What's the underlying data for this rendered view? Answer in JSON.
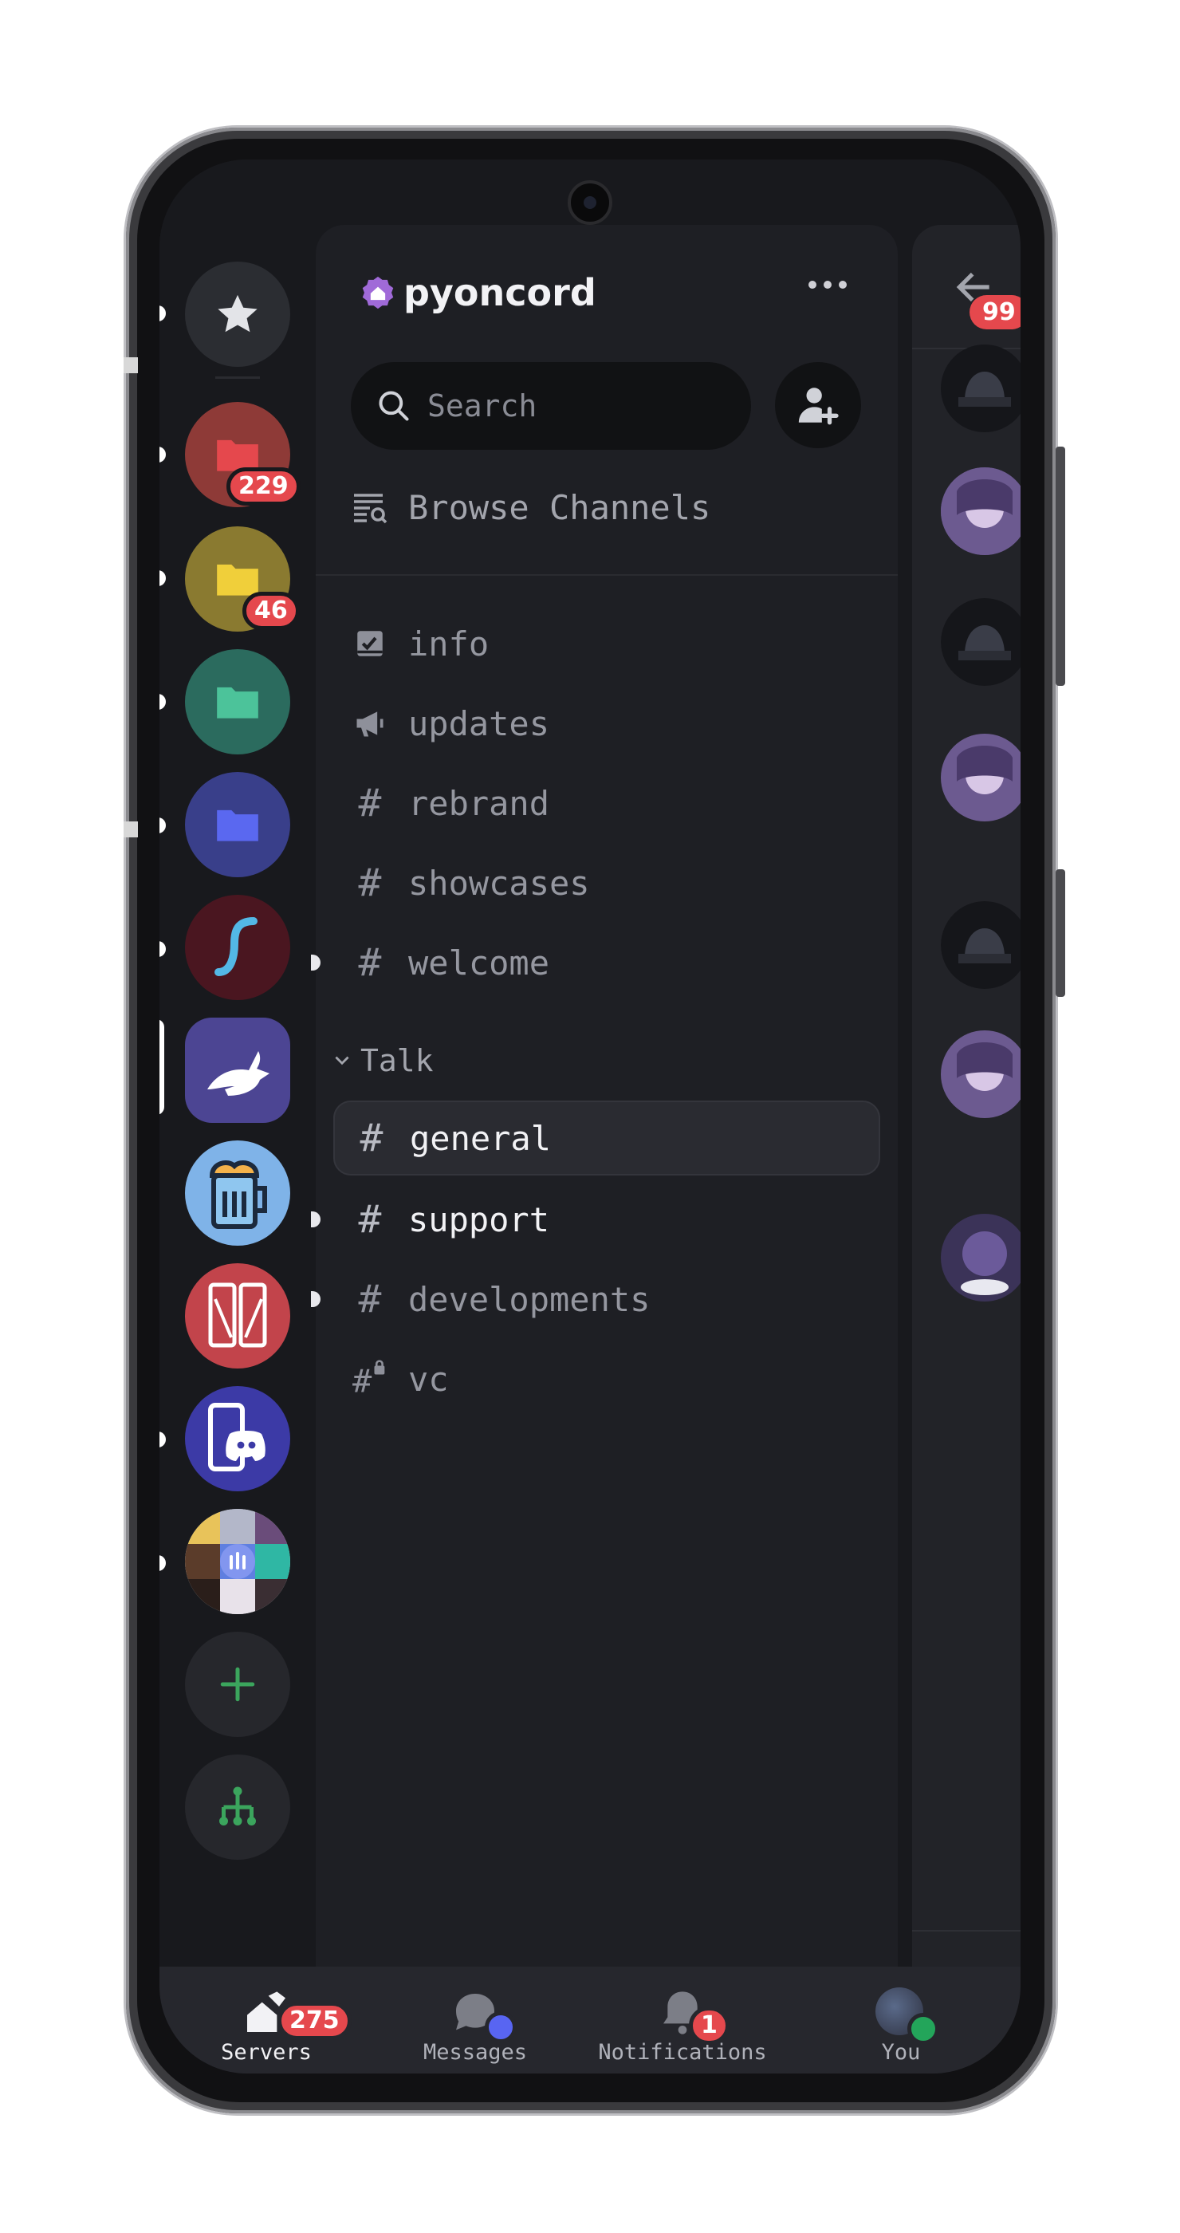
{
  "server_name": "pyoncord",
  "search": {
    "placeholder": "Search"
  },
  "browse_label": "Browse Channels",
  "servers": [
    {
      "icon": "star-icon",
      "color": "#2b2d32"
    },
    {
      "icon": "folder-icon",
      "color": "#8e3a37",
      "badge": "229"
    },
    {
      "icon": "folder-icon",
      "color": "#8a7a30",
      "badge": "46"
    },
    {
      "icon": "folder-icon",
      "color": "#2b6b5e"
    },
    {
      "icon": "folder-icon",
      "color": "#393f8a"
    },
    {
      "icon": "squiggle-icon",
      "color": "#4a1620"
    },
    {
      "icon": "rabbit-icon",
      "color": "#4c4593"
    },
    {
      "icon": "mug-icon",
      "color": "#7fb3e8"
    },
    {
      "icon": "phones-icon",
      "color": "#c2444b"
    },
    {
      "icon": "discord-phone-icon",
      "color": "#3c3aa6"
    },
    {
      "icon": "collage-avatar",
      "color": "#cfcfcf"
    },
    {
      "icon": "plus-icon",
      "color": "#26272c"
    },
    {
      "icon": "hub-icon",
      "color": "#26272c"
    }
  ],
  "channels": [
    {
      "name": "info",
      "icon": "rules-icon"
    },
    {
      "name": "updates",
      "icon": "megaphone-icon"
    },
    {
      "name": "rebrand",
      "icon": "hash-icon"
    },
    {
      "name": "showcases",
      "icon": "hash-icon"
    },
    {
      "name": "welcome",
      "icon": "hash-icon",
      "unread": true
    }
  ],
  "category": {
    "name": "Talk"
  },
  "talk_channels": [
    {
      "name": "general",
      "icon": "hash-icon",
      "selected": true
    },
    {
      "name": "support",
      "icon": "hash-icon",
      "unread": true
    },
    {
      "name": "developments",
      "icon": "hash-icon",
      "unread": true
    },
    {
      "name": "vc",
      "icon": "locked-hash-icon"
    }
  ],
  "right_pane": {
    "badge": "99"
  },
  "nav": {
    "servers": {
      "label": "Servers",
      "badge": "275"
    },
    "messages": {
      "label": "Messages"
    },
    "notifications": {
      "label": "Notifications",
      "badge": "1"
    },
    "you": {
      "label": "You"
    }
  },
  "colors": {
    "brand_blurple": "#5865f2",
    "danger": "#e5484d",
    "online": "#23a55a",
    "add": "#3ba55d"
  }
}
